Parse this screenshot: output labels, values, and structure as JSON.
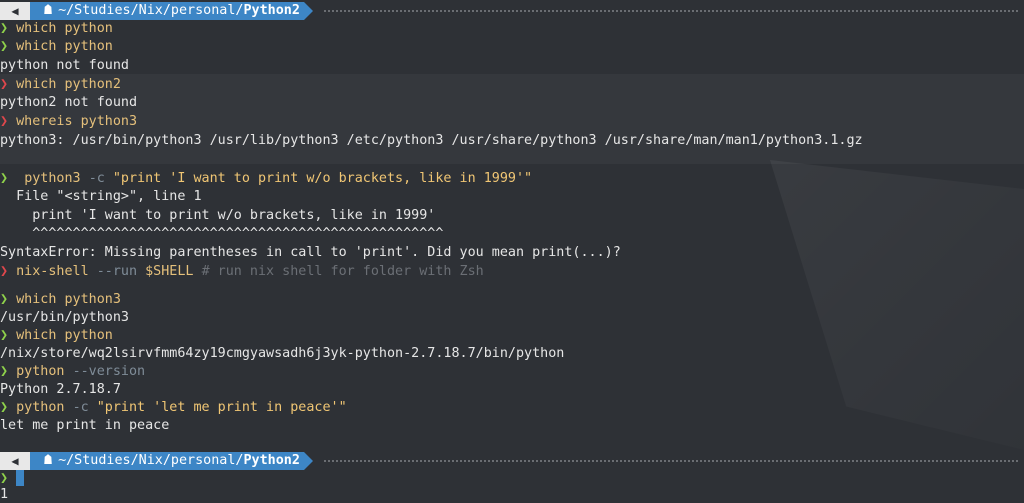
{
  "prompt": {
    "os_icon": "apple-logo-icon",
    "home_icon": "home-icon",
    "path_prefix": "~/Studies/Nix/personal/",
    "path_current": "Python2",
    "chevron": "❯"
  },
  "lines": [
    {
      "cmd": "which python"
    },
    {
      "cmd": "which python"
    },
    {
      "out": "python not found"
    },
    {
      "cmd": "which python2"
    },
    {
      "out": "python2 not found"
    },
    {
      "cmd": "whereis python3"
    },
    {
      "out": "python3: /usr/bin/python3 /usr/lib/python3 /etc/python3 /usr/share/python3 /usr/share/man/man1/python3.1.gz"
    },
    {
      "out": ""
    },
    {
      "cmd_head": "python3",
      "cmd_flag": "-c",
      "cmd_str": "\"print 'I want to print w/o brackets, like in 1999'\""
    },
    {
      "out": "  File \"<string>\", line 1"
    },
    {
      "out": "    print 'I want to print w/o brackets, like in 1999'"
    },
    {
      "out": "    ^^^^^^^^^^^^^^^^^^^^^^^^^^^^^^^^^^^^^^^^^^^^^^^^^^^"
    },
    {
      "out": "SyntaxError: Missing parentheses in call to 'print'. Did you mean print(...)?"
    },
    {
      "nix_cmd": "nix-shell",
      "nix_flag": "--run",
      "nix_var": "$SHELL",
      "nix_comment": "# run nix shell for folder with Zsh"
    },
    {
      "out": ""
    },
    {
      "cmd": "which python3"
    },
    {
      "out": "/usr/bin/python3"
    },
    {
      "cmd": "which python"
    },
    {
      "out": "/nix/store/wq2lsirvfmm64zy19cmgyawsadh6j3yk-python-2.7.18.7/bin/python"
    },
    {
      "cmd_head": "python",
      "cmd_flag": "--version"
    },
    {
      "out": "Python 2.7.18.7"
    },
    {
      "cmd_head": "python",
      "cmd_flag": "-c",
      "cmd_str": "\"print 'let me print in peace'\""
    },
    {
      "out": "let me print in peace"
    }
  ],
  "statusline": {
    "line_number": "1"
  },
  "colors": {
    "background": "#2e3136",
    "path_segment": "#3d86c6",
    "prompt_ok": "#8fd24b",
    "prompt_error": "#e0474c"
  }
}
